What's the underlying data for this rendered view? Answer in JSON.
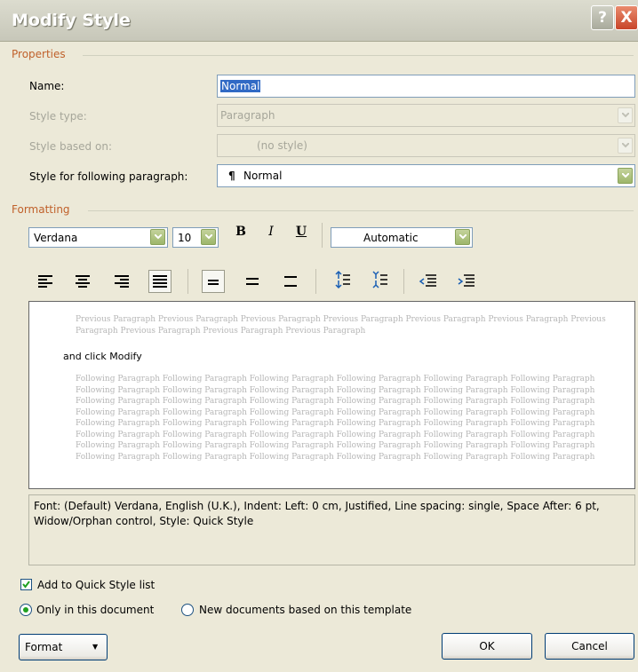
{
  "window": {
    "title": "Modify Style",
    "help_label": "?",
    "close_label": "X"
  },
  "properties": {
    "group_label": "Properties",
    "name_label": "Name:",
    "name_value": "Normal",
    "style_type_label": "Style type:",
    "style_type_value": "Paragraph",
    "based_on_label": "Style based on:",
    "based_on_value": "(no style)",
    "following_label": "Style for following paragraph:",
    "following_value": "Normal"
  },
  "formatting": {
    "group_label": "Formatting",
    "font": "Verdana",
    "size": "10",
    "bold": "B",
    "italic": "I",
    "underline": "U",
    "color": "Automatic"
  },
  "preview": {
    "previous_text": "Previous Paragraph Previous Paragraph Previous Paragraph Previous Paragraph Previous Paragraph Previous Paragraph Previous Paragraph Previous Paragraph Previous Paragraph Previous Paragraph",
    "sample_text": "and click Modify",
    "following_text": "Following Paragraph Following Paragraph Following Paragraph Following Paragraph Following Paragraph Following Paragraph Following Paragraph Following Paragraph Following Paragraph Following Paragraph Following Paragraph Following Paragraph Following Paragraph Following Paragraph Following Paragraph Following Paragraph Following Paragraph Following Paragraph Following Paragraph Following Paragraph Following Paragraph Following Paragraph Following Paragraph Following Paragraph Following Paragraph Following Paragraph Following Paragraph Following Paragraph Following Paragraph Following Paragraph Following Paragraph Following Paragraph Following Paragraph Following Paragraph Following Paragraph Following Paragraph Following Paragraph Following Paragraph Following Paragraph Following Paragraph Following Paragraph Following Paragraph Following Paragraph Following Paragraph Following Paragraph Following Paragraph Following Paragraph Following Paragraph"
  },
  "description": "Font: (Default) Verdana, English (U.K.), Indent: Left:  0 cm, Justified, Line spacing:  single, Space After:  6 pt, Widow/Orphan control, Style: Quick Style",
  "options": {
    "quick_style_label": "Add to Quick Style list",
    "quick_style_checked": true,
    "only_doc_label": "Only in this document",
    "new_docs_label": "New documents based on this template"
  },
  "buttons": {
    "format": "Format",
    "ok": "OK",
    "cancel": "Cancel"
  }
}
